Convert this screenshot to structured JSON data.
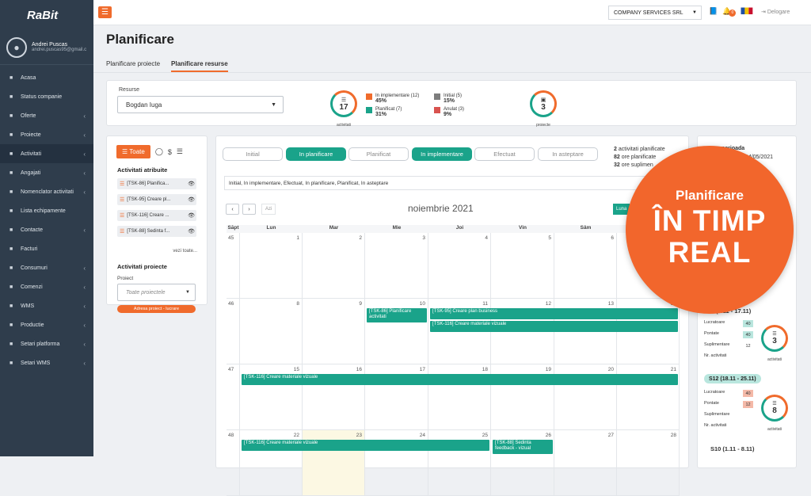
{
  "app": {
    "logo": "RaBit"
  },
  "user": {
    "name": "Andrei Puscas",
    "email": "andrei.puscas95@gmail.c"
  },
  "sidebar": {
    "items": [
      {
        "label": "Acasa",
        "icon": "home-icon",
        "chev": ""
      },
      {
        "label": "Status companie",
        "icon": "chart-icon",
        "chev": ""
      },
      {
        "label": "Oferte",
        "icon": "file-icon",
        "chev": "‹"
      },
      {
        "label": "Proiecte",
        "icon": "file-icon",
        "chev": "‹"
      },
      {
        "label": "Activitati",
        "icon": "tag-icon",
        "chev": "‹"
      },
      {
        "label": "Angajati",
        "icon": "user-icon",
        "chev": "‹"
      },
      {
        "label": "Nomenclator activitati",
        "icon": "list-icon",
        "chev": "‹"
      },
      {
        "label": "Lista echipamente",
        "icon": "list-icon",
        "chev": ""
      },
      {
        "label": "Contacte",
        "icon": "contact-icon",
        "chev": "‹"
      },
      {
        "label": "Facturi",
        "icon": "invoice-icon",
        "chev": ""
      },
      {
        "label": "Consumuri",
        "icon": "cart-icon",
        "chev": "‹"
      },
      {
        "label": "Comenzi",
        "icon": "order-icon",
        "chev": "‹"
      },
      {
        "label": "WMS",
        "icon": "warehouse-icon",
        "chev": "‹"
      },
      {
        "label": "Productie",
        "icon": "factory-icon",
        "chev": "‹"
      },
      {
        "label": "Setari platforma",
        "icon": "wrench-icon",
        "chev": "‹"
      },
      {
        "label": "Setari WMS",
        "icon": "wrench-icon",
        "chev": "‹"
      }
    ]
  },
  "topbar": {
    "company": "COMPANY SERVICES SRL",
    "notifications": "0",
    "logout": "Delogare"
  },
  "page": {
    "title": "Planificare",
    "tabs": [
      "Planificare proiecte",
      "Planificare resurse"
    ]
  },
  "resurse": {
    "label": "Resurse",
    "value": "Bogdan Iuga"
  },
  "stats": {
    "activitati_count": "17",
    "activitati_label": "activitati",
    "proiecte_count": "3",
    "proiecte_label": "proiecte",
    "legend": [
      {
        "name": "In implementare (12)",
        "pct": "45%",
        "color": "#f06b2c"
      },
      {
        "name": "Planificat (7)",
        "pct": "31%",
        "color": "#1aa38a"
      },
      {
        "name": "Initial (5)",
        "pct": "15%",
        "color": "#7d7d7d"
      },
      {
        "name": "Anulat (3)",
        "pct": "9%",
        "color": "#d9534f"
      }
    ]
  },
  "left": {
    "toate": "Toate",
    "attr_title": "Activitati atribuite",
    "items": [
      "[TSK-86] Planifica...",
      "[TSK-95] Creare pl...",
      "[TSK-116] Creare ...",
      "[TSK-88] Sedinta f..."
    ],
    "vezi": "vezi toate...",
    "proj_title": "Activitati proiecte",
    "proj_label": "Proiect",
    "proj_placeholder": "Toate proiectele",
    "adresa": "Adresa proiect - lucrare"
  },
  "filters": [
    "Initial",
    "In planificare",
    "Planificat",
    "In implementare",
    "Efectuat",
    "In asteptare"
  ],
  "summary": {
    "l1a": "2",
    "l1b": " activitati planificate",
    "l2a": "82",
    "l2b": " ore planificate",
    "l3a": "32",
    "l3b": " ore suplimen"
  },
  "status_text": "Initial, In implementare, Efectuat, In planificare, Planificat, In asteptare",
  "calendar": {
    "azi": "Azi",
    "month": "noiembrie 2021",
    "luna": "Luna",
    "headers": [
      "Săpt",
      "Lun",
      "Mar",
      "Mie",
      "Joi",
      "Vin",
      "Sâm",
      "Dum"
    ],
    "weeks": [
      {
        "wk": "45",
        "days": [
          "1",
          "2",
          "3",
          "4",
          "5",
          "6",
          "7"
        ]
      },
      {
        "wk": "46",
        "days": [
          "8",
          "9",
          "10",
          "11",
          "12",
          "13",
          "14"
        ]
      },
      {
        "wk": "47",
        "days": [
          "15",
          "16",
          "17",
          "18",
          "19",
          "20",
          "21"
        ]
      },
      {
        "wk": "48",
        "days": [
          "22",
          "23",
          "24",
          "25",
          "26",
          "27",
          "28"
        ]
      }
    ],
    "events": [
      {
        "text": "[TSK-86] Planificare activitati",
        "week": 1,
        "start": 2,
        "span": 1,
        "row": 0,
        "tall": true
      },
      {
        "text": "[TSK-95] Creare plan business",
        "week": 1,
        "start": 3,
        "span": 4,
        "row": 0,
        "tall": false
      },
      {
        "text": "[TSK-116] Creare materiale vizuale",
        "week": 1,
        "start": 3,
        "span": 4,
        "row": 1,
        "tall": false
      },
      {
        "text": "[TSK-116] Creare materiale vizuale",
        "week": 2,
        "start": 0,
        "span": 7,
        "row": 0,
        "tall": false
      },
      {
        "text": "[TSK-116] Creare materiale vizuale",
        "week": 3,
        "start": 0,
        "span": 4,
        "row": 0,
        "tall": false
      },
      {
        "text": "[TSK-88] Sedinta feedback - vizual",
        "week": 3,
        "start": 4,
        "span": 1,
        "row": 0,
        "tall": true
      }
    ]
  },
  "right": {
    "perioada": "perioada",
    "date": "14/05/2021",
    "week1": "S11 (8.11 - 17.11)",
    "week2": "S12 (18.11 - 25.11)",
    "week3": "S10 (1.11 - 8.11)",
    "kv_labels": [
      "Lucratoare",
      "Pontate",
      "Suplimentare",
      "Nr. activitati"
    ],
    "w1_vals": [
      "40",
      "40",
      "12"
    ],
    "w1_count": "3",
    "w2_vals": [
      "40",
      "12"
    ],
    "w2_count": "8",
    "ring_label": "activitati"
  },
  "promo": {
    "line1": "Planificare",
    "line2": "ÎN TIMP",
    "line3": "REAL"
  }
}
